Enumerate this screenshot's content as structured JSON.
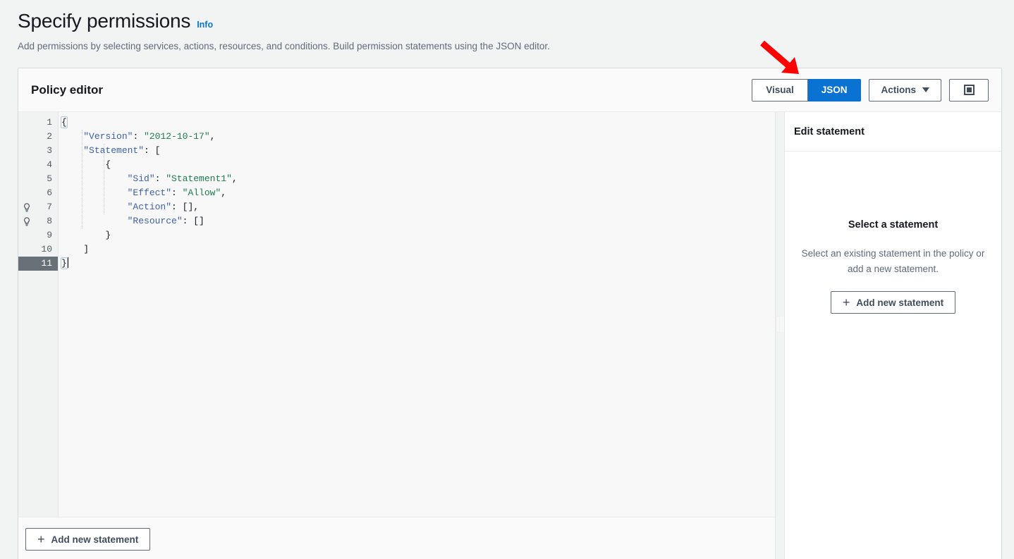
{
  "header": {
    "title": "Specify permissions",
    "info_label": "Info",
    "subtitle": "Add permissions by selecting services, actions, resources, and conditions. Build permission statements using the JSON editor."
  },
  "policy_editor": {
    "title": "Policy editor",
    "toggle": {
      "options": [
        "Visual",
        "JSON"
      ],
      "selected": "JSON"
    },
    "actions_label": "Actions",
    "expand_icon": "nested-square-icon",
    "footer_button": "Add new statement"
  },
  "code_editor": {
    "active_line": 11,
    "hint_lines": [
      7,
      8
    ],
    "lines": [
      {
        "num": 1,
        "fold": true,
        "tokens": [
          {
            "t": "{",
            "c": "p"
          }
        ]
      },
      {
        "num": 2,
        "fold": false,
        "tokens": [
          {
            "t": "    ",
            "c": "p"
          },
          {
            "t": "\"Version\"",
            "c": "k"
          },
          {
            "t": ": ",
            "c": "p"
          },
          {
            "t": "\"2012-10-17\"",
            "c": "s"
          },
          {
            "t": ",",
            "c": "p"
          }
        ]
      },
      {
        "num": 3,
        "fold": true,
        "tokens": [
          {
            "t": "    ",
            "c": "p"
          },
          {
            "t": "\"Statement\"",
            "c": "k"
          },
          {
            "t": ": [",
            "c": "p"
          }
        ]
      },
      {
        "num": 4,
        "fold": true,
        "tokens": [
          {
            "t": "        {",
            "c": "p"
          }
        ]
      },
      {
        "num": 5,
        "fold": false,
        "tokens": [
          {
            "t": "            ",
            "c": "p"
          },
          {
            "t": "\"Sid\"",
            "c": "k"
          },
          {
            "t": ": ",
            "c": "p"
          },
          {
            "t": "\"Statement1\"",
            "c": "s"
          },
          {
            "t": ",",
            "c": "p"
          }
        ]
      },
      {
        "num": 6,
        "fold": false,
        "tokens": [
          {
            "t": "            ",
            "c": "p"
          },
          {
            "t": "\"Effect\"",
            "c": "k"
          },
          {
            "t": ": ",
            "c": "p"
          },
          {
            "t": "\"Allow\"",
            "c": "s"
          },
          {
            "t": ",",
            "c": "p"
          }
        ]
      },
      {
        "num": 7,
        "fold": false,
        "tokens": [
          {
            "t": "            ",
            "c": "p"
          },
          {
            "t": "\"Action\"",
            "c": "k"
          },
          {
            "t": ": [],",
            "c": "p"
          }
        ]
      },
      {
        "num": 8,
        "fold": false,
        "tokens": [
          {
            "t": "            ",
            "c": "p"
          },
          {
            "t": "\"Resource\"",
            "c": "k"
          },
          {
            "t": ": []",
            "c": "p"
          }
        ]
      },
      {
        "num": 9,
        "fold": false,
        "tokens": [
          {
            "t": "        }",
            "c": "p"
          }
        ]
      },
      {
        "num": 10,
        "fold": false,
        "tokens": [
          {
            "t": "    ]",
            "c": "p"
          }
        ]
      },
      {
        "num": 11,
        "fold": false,
        "tokens": [
          {
            "t": "}",
            "c": "p"
          }
        ]
      }
    ]
  },
  "edit_statement_panel": {
    "title": "Edit statement",
    "empty_title": "Select a statement",
    "empty_description": "Select an existing statement in the policy or add a new statement.",
    "add_button": "Add new statement"
  },
  "annotation": {
    "arrow_color": "#ff0000",
    "points_to": "JSON"
  },
  "colors": {
    "accent": "#0972d3",
    "link": "#0972d3",
    "text": "#16191f",
    "muted": "#5f6b7a",
    "json_key": "#3b5fa8",
    "json_string": "#1d7d4d",
    "active_line_bg": "#687078"
  }
}
